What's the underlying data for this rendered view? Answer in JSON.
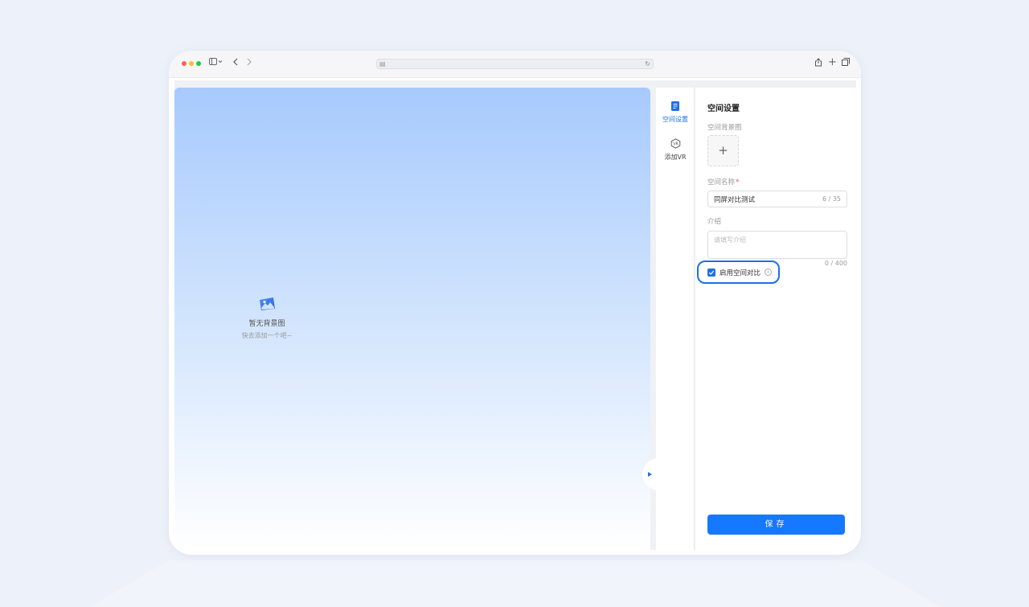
{
  "canvas": {
    "empty_title": "暂无背景图",
    "empty_subtitle": "快去添加一个吧~"
  },
  "sidebar": {
    "items": [
      {
        "label": "空间设置",
        "icon": "document-icon",
        "active": true
      },
      {
        "label": "添加VR",
        "icon": "vr-icon",
        "active": false
      }
    ]
  },
  "panel": {
    "title": "空间设置",
    "background_label": "空间背景图",
    "upload_symbol": "+",
    "name_label": "空间名称",
    "name_required_mark": "*",
    "name_value": "同屏对比测试",
    "name_count": "6 / 35",
    "intro_label": "介绍",
    "intro_placeholder": "请填写介绍",
    "intro_count": "0 / 400",
    "compare_label": "启用空间对比",
    "compare_checked": true,
    "save_label": "保存"
  },
  "colors": {
    "accent": "#1f6fe5",
    "button": "#1677ff",
    "required": "#f04b4b"
  }
}
